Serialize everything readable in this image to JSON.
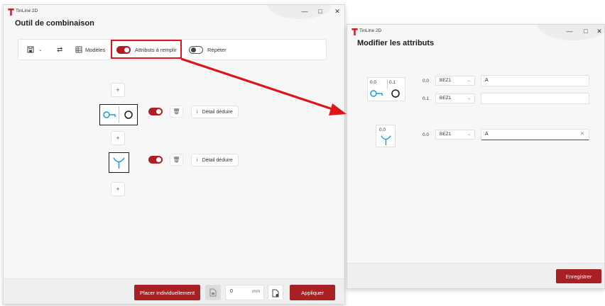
{
  "main_window": {
    "app_name": "TinLine 2D",
    "title": "Outil de combinaison",
    "toolbar": {
      "models_label": "Modèles",
      "attributes_label": "Attributs à remplir",
      "repeat_label": "Répéter"
    },
    "rows": [
      {
        "symbol": "key-circle",
        "detail_label": "Détail déduire"
      },
      {
        "symbol": "y-junction",
        "detail_label": "Détail déduire"
      }
    ],
    "footer": {
      "place_label": "Placer individuellement",
      "distance_value": "0",
      "distance_unit": "mm",
      "apply_label": "Appliquer"
    }
  },
  "attributes_window": {
    "app_name": "TinLine 2D",
    "title": "Modifier les attributs",
    "groups": [
      {
        "symbol_labels": [
          "0.0",
          "0.1"
        ],
        "rows": [
          {
            "index": "0.0",
            "attribute": "BEZ1",
            "value": "A"
          },
          {
            "index": "0.1",
            "attribute": "BEZ1",
            "value": ""
          }
        ]
      },
      {
        "symbol_labels": [
          "0.0"
        ],
        "rows": [
          {
            "index": "0.0",
            "attribute": "BEZ1",
            "value": "A"
          }
        ]
      }
    ],
    "save_label": "Enregistrer"
  },
  "colors": {
    "accent": "#a82024",
    "symbol_blue": "#1a9de0",
    "annotation_red": "#e0141a"
  }
}
